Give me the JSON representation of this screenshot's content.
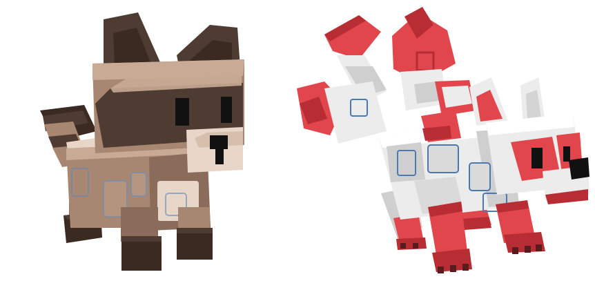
{
  "scene": {
    "background": "#ffffff",
    "models": [
      {
        "name": "raccoon",
        "palette": {
          "fur_light": "#c9ab95",
          "fur_mid": "#a88772",
          "fur_shadow": "#8b6c5b",
          "mask": "#4e3b31",
          "dark": "#3a2a22",
          "snout": "#e8d7c8",
          "eye": "#111111",
          "accent": "#5f87b8"
        }
      },
      {
        "name": "nine-tailed-fox",
        "palette": {
          "white": "#ececec",
          "grey": "#cfcfcf",
          "grey_dark": "#9b9b9b",
          "red": "#e0464c",
          "red_dark": "#b82c33",
          "claw": "#5a1b1e",
          "eye": "#111111",
          "accent": "#4a78b0"
        }
      }
    ]
  }
}
